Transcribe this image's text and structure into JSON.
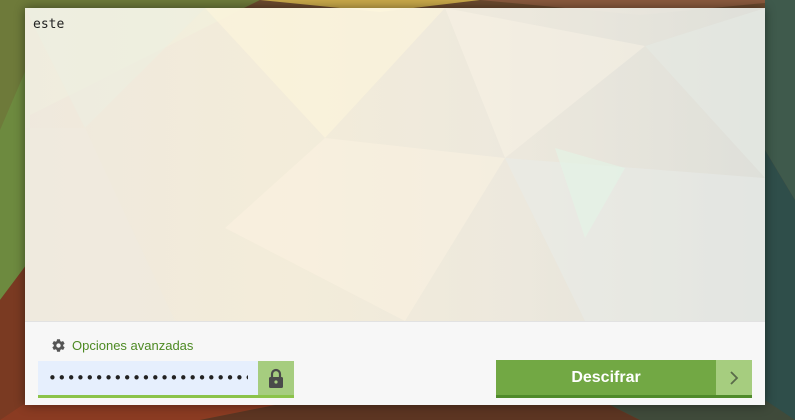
{
  "editor": {
    "text": "este"
  },
  "options": {
    "advanced_label": "Opciones avanzadas"
  },
  "password": {
    "value": "••••••••••••••••••••••••"
  },
  "actions": {
    "decrypt_label": "Descifrar"
  },
  "icons": {
    "advanced": "gear-icon",
    "password_visibility": "lock-icon",
    "decrypt_arrow": "chevron-right-icon"
  },
  "colors": {
    "accent_green": "#72a844",
    "accent_light_green": "#a6cd7f",
    "link_green": "#4d8a23",
    "password_bg": "#e6effd"
  }
}
